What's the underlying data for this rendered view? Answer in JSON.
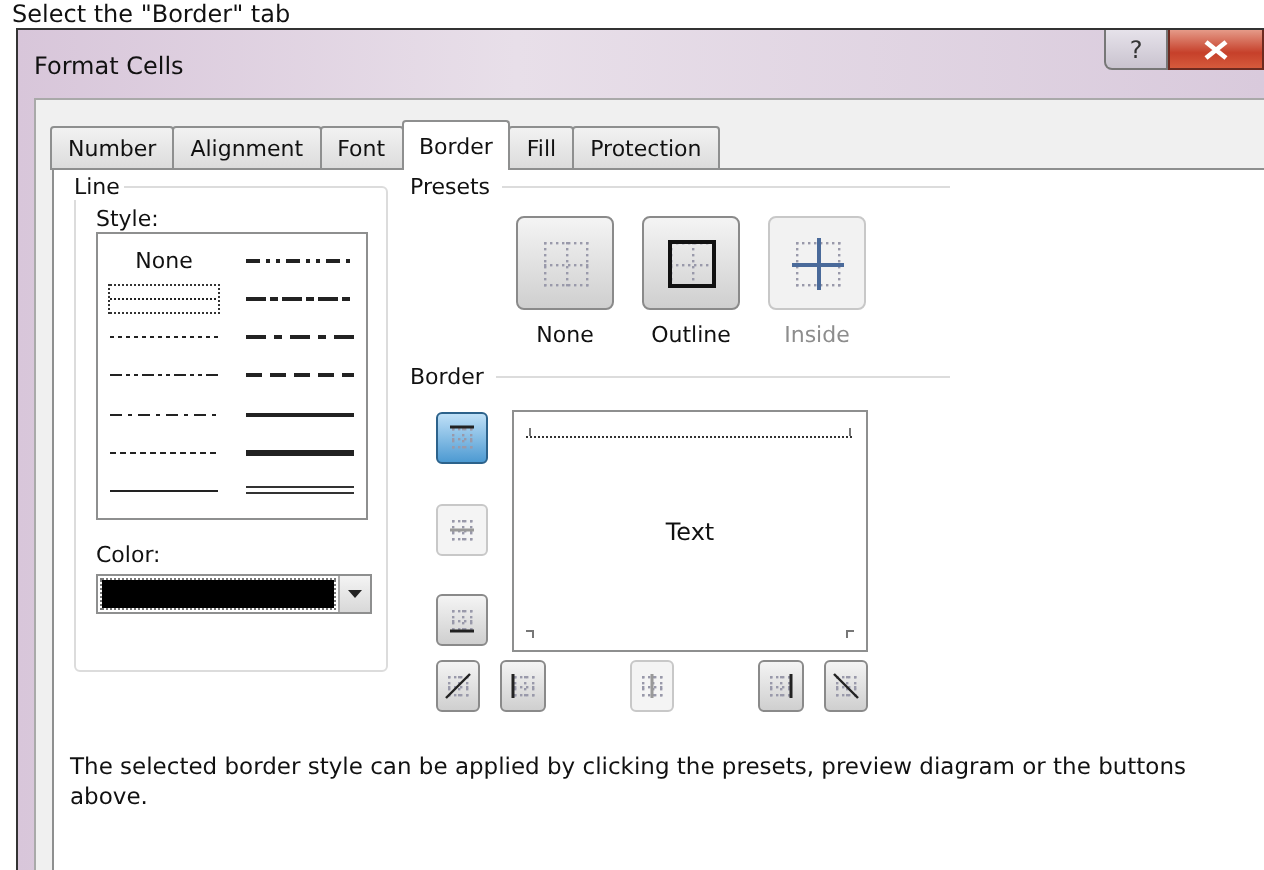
{
  "caption": "Select the \"Border\" tab",
  "window": {
    "title": "Format Cells",
    "help": "?"
  },
  "tabs": [
    {
      "label": "Number",
      "selected": false
    },
    {
      "label": "Alignment",
      "selected": false
    },
    {
      "label": "Font",
      "selected": false
    },
    {
      "label": "Border",
      "selected": true
    },
    {
      "label": "Fill",
      "selected": false
    },
    {
      "label": "Protection",
      "selected": false
    }
  ],
  "line": {
    "title": "Line",
    "style_label": "Style:",
    "color_label": "Color:",
    "color": "#000000",
    "styles": [
      {
        "kind": "none",
        "label": "None",
        "selected": false
      },
      {
        "kind": "hair",
        "selected": true
      },
      {
        "kind": "dotted",
        "selected": false
      },
      {
        "kind": "dash-dot-dot",
        "selected": false
      },
      {
        "kind": "dash-dot",
        "selected": false
      },
      {
        "kind": "dashed",
        "selected": false
      },
      {
        "kind": "thin",
        "selected": false
      },
      {
        "kind": "medium-dash-dot-dot",
        "selected": false
      },
      {
        "kind": "slanted-dash-dot",
        "selected": false
      },
      {
        "kind": "medium-dash-dot",
        "selected": false
      },
      {
        "kind": "medium-dashed",
        "selected": false
      },
      {
        "kind": "medium",
        "selected": false
      },
      {
        "kind": "thick",
        "selected": false
      },
      {
        "kind": "double",
        "selected": false
      }
    ]
  },
  "presets": {
    "title": "Presets",
    "items": [
      {
        "kind": "none",
        "label": "None",
        "disabled": false
      },
      {
        "kind": "outline",
        "label": "Outline",
        "disabled": false
      },
      {
        "kind": "inside",
        "label": "Inside",
        "disabled": true
      }
    ]
  },
  "border": {
    "title": "Border",
    "preview_text": "Text",
    "side_buttons": [
      {
        "kind": "top",
        "pressed": true,
        "disabled": false
      },
      {
        "kind": "middle",
        "pressed": false,
        "disabled": true
      },
      {
        "kind": "bottom",
        "pressed": false,
        "disabled": false
      }
    ],
    "bottom_buttons": [
      {
        "kind": "diagonal-up",
        "pressed": false,
        "disabled": false
      },
      {
        "kind": "left",
        "pressed": false,
        "disabled": false
      },
      {
        "kind": "center",
        "pressed": false,
        "disabled": true
      },
      {
        "kind": "right",
        "pressed": false,
        "disabled": false
      },
      {
        "kind": "diagonal-down",
        "pressed": false,
        "disabled": false
      }
    ]
  },
  "description": "The selected border style can be applied by clicking the presets, preview diagram or the buttons above."
}
